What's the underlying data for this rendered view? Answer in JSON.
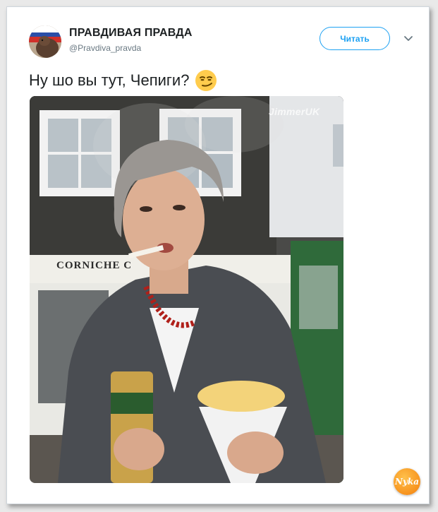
{
  "tweet": {
    "author": {
      "name": "ПРАВДИВАЯ ПРАВДА",
      "handle": "@Pravdiva_pravda"
    },
    "follow_button": {
      "label": "Читать"
    },
    "menu_icon": "chevron-down-icon",
    "text": "Ну шо вы тут, Чепиги?",
    "emoji": "smirking-face-emoji",
    "photo": {
      "watermark": "JimmerUK",
      "shop_sign": "CORNICHE C"
    }
  },
  "site_logo": {
    "text": "Nyka"
  },
  "colors": {
    "accent": "#1da1f2",
    "text": "#1c2022",
    "muted": "#697882",
    "logo": "#f7931e"
  }
}
